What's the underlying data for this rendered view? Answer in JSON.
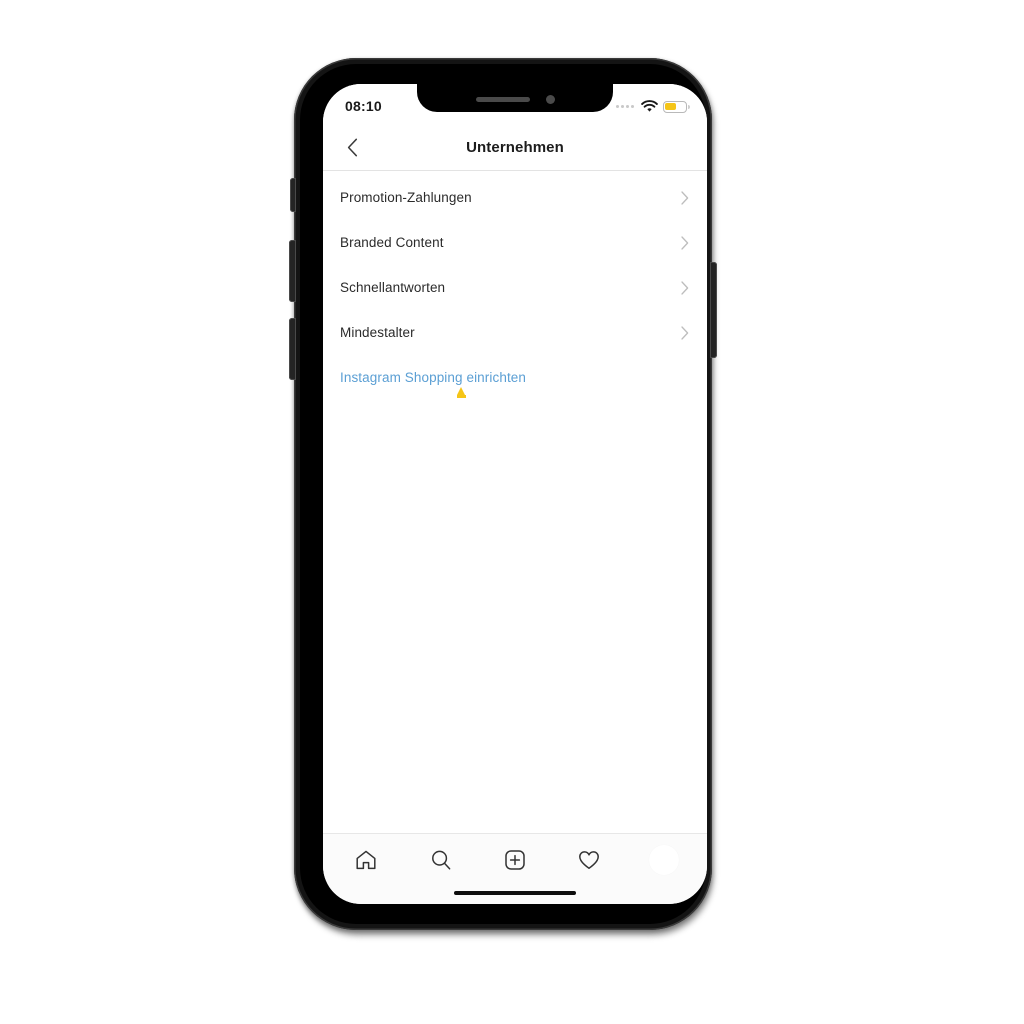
{
  "device": {
    "frame_color": "#141414",
    "screen_bg": "#ffffff"
  },
  "status_bar": {
    "time": "08:10",
    "signal_icon": "signal-dots-icon",
    "wifi_icon": "wifi-icon",
    "battery_icon": "battery-icon",
    "battery_color": "#f5c518",
    "battery_level_percent": 55
  },
  "nav": {
    "back_icon": "chevron-left-icon",
    "title": "Unternehmen"
  },
  "list": {
    "rows": [
      {
        "label": "Promotion-Zahlungen",
        "chevron": "chevron-right-icon"
      },
      {
        "label": "Branded Content",
        "chevron": "chevron-right-icon"
      },
      {
        "label": "Schnellantworten",
        "chevron": "chevron-right-icon"
      },
      {
        "label": "Mindestalter",
        "chevron": "chevron-right-icon"
      }
    ],
    "link": {
      "label": "Instagram Shopping einrichten",
      "color": "#5b9fd4"
    }
  },
  "tab_bar": {
    "items": [
      {
        "name": "home-icon",
        "label": "Home"
      },
      {
        "name": "search-icon",
        "label": "Suche"
      },
      {
        "name": "add-post-icon",
        "label": "Beitrag erstellen"
      },
      {
        "name": "heart-icon",
        "label": "Aktivität"
      },
      {
        "name": "profile-avatar",
        "label": "Profil"
      }
    ]
  }
}
